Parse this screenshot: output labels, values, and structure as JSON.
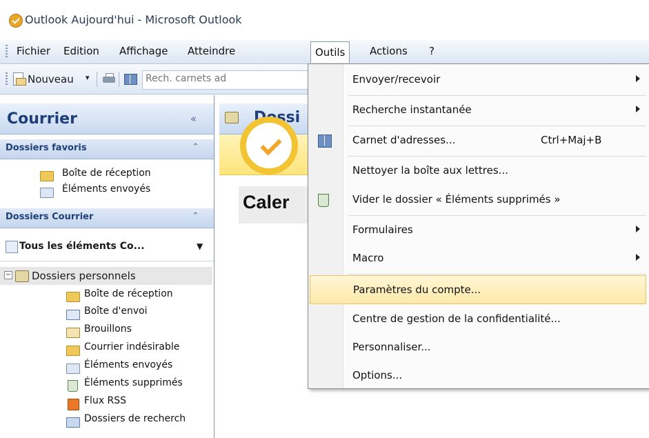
{
  "window": {
    "title": "Outlook Aujourd'hui - Microsoft Outlook"
  },
  "menubar": {
    "items": [
      {
        "label": "Fichier",
        "ul": "F"
      },
      {
        "label": "Edition",
        "ul": "E"
      },
      {
        "label": "Affichage",
        "ul": "A"
      },
      {
        "label": "Atteindre",
        "ul": "n"
      },
      {
        "label": "Outils",
        "ul": "O"
      },
      {
        "label": "Actions",
        "ul": "c"
      },
      {
        "label": "?",
        "ul": "?"
      }
    ]
  },
  "toolbar": {
    "new_label": "Nouveau",
    "new_dropdown": "▾",
    "search_placeholder": "Rech. carnets ad"
  },
  "nav": {
    "title": "Courrier",
    "collapse": "«",
    "favorites_header": "Dossiers favoris",
    "favorites": [
      "Boîte de réception",
      "Éléments envoyés"
    ],
    "mail_header": "Dossiers Courrier",
    "all_items": "Tous les éléments Co...",
    "root_folder": "Dossiers personnels",
    "folders": [
      "Boîte de réception",
      "Boîte d'envoi",
      "Brouillons",
      "Courrier indésirable",
      "Éléments envoyés",
      "Éléments supprimés",
      "Flux RSS",
      "Dossiers de recherch"
    ]
  },
  "content": {
    "header_title": "Dossi",
    "calendar_label": "Caler"
  },
  "outils_menu": {
    "items": [
      {
        "label": "Envoyer/recevoir",
        "submenu": true
      },
      {
        "label": "Recherche instantanée",
        "submenu": true
      },
      {
        "label": "Carnet d'adresses...",
        "shortcut": "Ctrl+Maj+B",
        "icon": "address-book-icon"
      },
      {
        "label": "Nettoyer la boîte aux lettres..."
      },
      {
        "label": "Vider le dossier « Éléments supprimés »",
        "icon": "recycle-bin-icon"
      },
      {
        "label": "Formulaires",
        "submenu": true
      },
      {
        "label": "Macro",
        "submenu": true
      },
      {
        "label": "Paramètres du compte...",
        "highlighted": true
      },
      {
        "label": "Centre de gestion de la confidentialité..."
      },
      {
        "label": "Personnaliser..."
      },
      {
        "label": "Options..."
      }
    ]
  },
  "colors": {
    "highlight": "#fde9a9",
    "nav_header": "#c8d9f0",
    "accent_text": "#1e3f7a"
  }
}
